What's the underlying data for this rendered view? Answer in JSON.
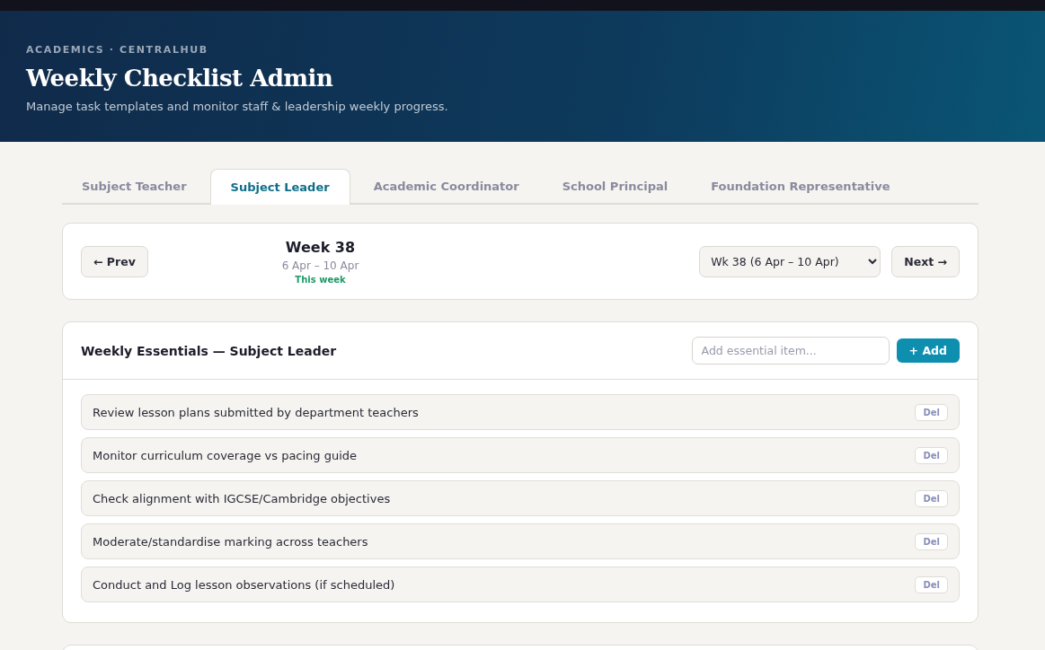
{
  "header": {
    "eyebrow": "ACADEMICS · CENTRALHUB",
    "title": "Weekly Checklist Admin",
    "subtitle": "Manage task templates and monitor staff & leadership weekly progress."
  },
  "tabs": [
    {
      "label": "Subject Teacher",
      "selected": false
    },
    {
      "label": "Subject Leader",
      "selected": true
    },
    {
      "label": "Academic Coordinator",
      "selected": false
    },
    {
      "label": "School Principal",
      "selected": false
    },
    {
      "label": "Foundation Representative",
      "selected": false
    }
  ],
  "week_nav": {
    "prev": "← Prev",
    "week": "Week 38",
    "range": "6 Apr – 10 Apr",
    "note": "This week",
    "select": "Wk 38 (6 Apr – 10 Apr)",
    "next": "Next →"
  },
  "essentials": {
    "title": "Weekly Essentials — Subject Leader",
    "placeholder": "Add essential item...",
    "add": "+ Add",
    "items": [
      {
        "text": "Review lesson plans submitted by department teachers",
        "action": "Del"
      },
      {
        "text": "Monitor curriculum coverage vs pacing guide",
        "action": "Del"
      },
      {
        "text": "Check alignment with IGCSE/Cambridge objectives",
        "action": "Del"
      },
      {
        "text": "Moderate/standardise marking across teachers",
        "action": "Del"
      },
      {
        "text": "Conduct and Log lesson observations (if scheduled)",
        "action": "Del"
      }
    ]
  }
}
